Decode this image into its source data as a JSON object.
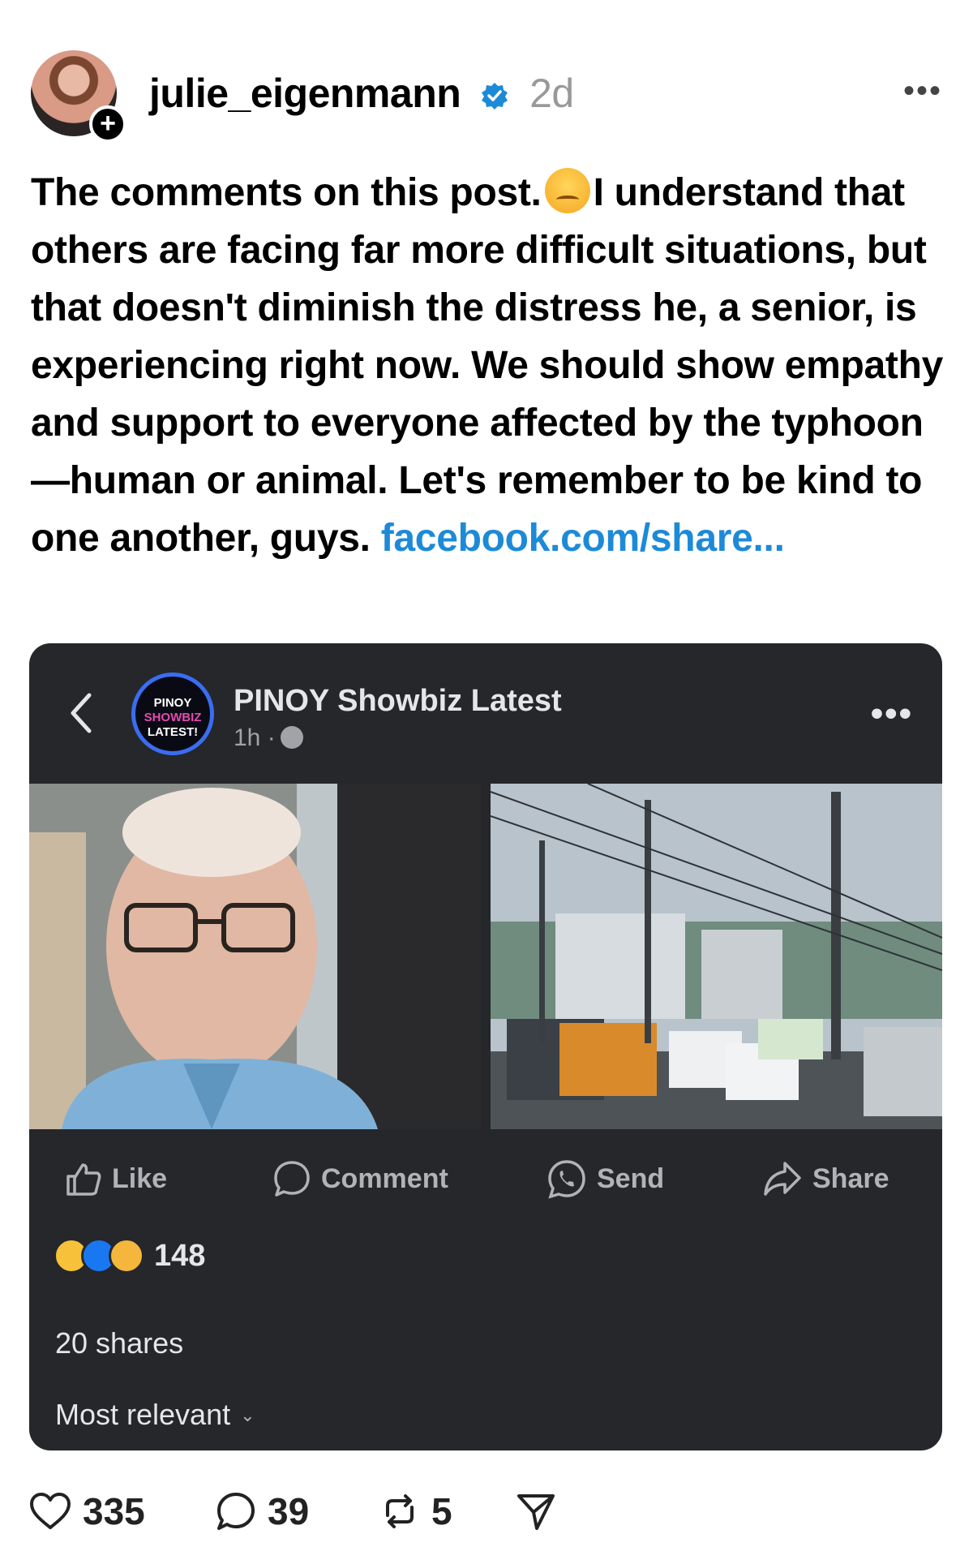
{
  "post": {
    "username": "julie_eigenmann",
    "age": "2d",
    "text_before_emoji": "The comments on this post.",
    "text_after_emoji": "I understand that others are facing far more difficult situations, but that doesn't diminish the distress he, a senior, is experiencing right now. We should show empathy and support to everyone affected by the typhoon—human or animal. Let's remember to be kind to one another, guys. ",
    "link": "facebook.com/share..."
  },
  "embed": {
    "page_name": "PINOY Showbiz Latest",
    "page_time": "1h ·",
    "logo_line1": "PINOY",
    "logo_line2": "SHOWBIZ",
    "logo_line3": "LATEST!",
    "actions": {
      "like": "Like",
      "comment": "Comment",
      "send": "Send",
      "share": "Share"
    },
    "reaction_count": "148",
    "shares": "20 shares",
    "sort": "Most relevant"
  },
  "footer": {
    "likes": "335",
    "comments": "39",
    "reposts": "5"
  },
  "icons": [
    "plus-icon",
    "verified-icon",
    "more-icon",
    "back-icon",
    "globe-icon",
    "like-icon",
    "comment-icon",
    "send-icon",
    "share-icon",
    "heart-icon",
    "reply-icon",
    "repost-icon",
    "paper-plane-icon"
  ],
  "colors": {
    "link": "#1d8ad8",
    "card_bg": "#25272b",
    "verified": "#1d8ad8"
  }
}
